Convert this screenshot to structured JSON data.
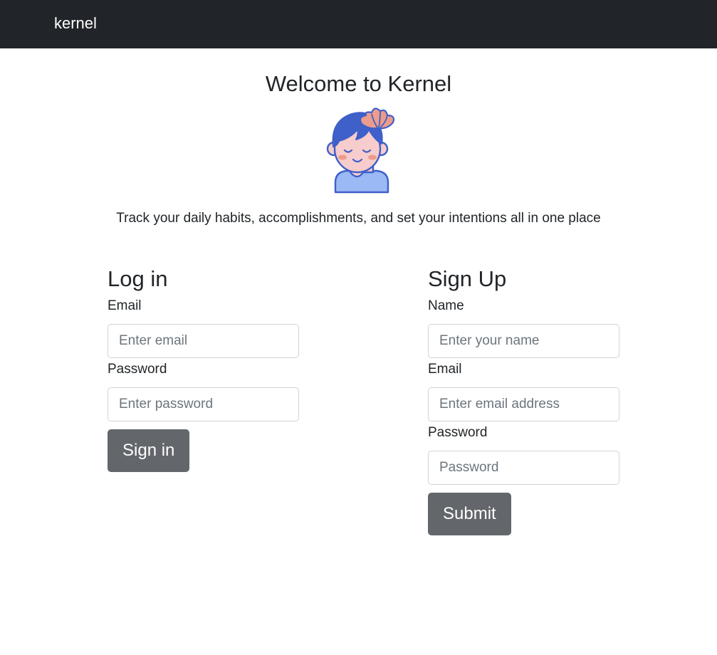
{
  "navbar": {
    "brand": "kernel"
  },
  "hero": {
    "title": "Welcome to Kernel",
    "mascot_icon": "meditating-person-icon",
    "tagline": "Track your daily habits, accomplishments, and set your intentions all in one place"
  },
  "login": {
    "heading": "Log in",
    "email_label": "Email",
    "email_placeholder": "Enter email",
    "email_value": "",
    "password_label": "Password",
    "password_placeholder": "Enter password",
    "password_value": "",
    "submit_label": "Sign in"
  },
  "signup": {
    "heading": "Sign Up",
    "name_label": "Name",
    "name_placeholder": "Enter your name",
    "name_value": "",
    "email_label": "Email",
    "email_placeholder": "Enter email address",
    "email_value": "",
    "password_label": "Password",
    "password_placeholder": "Password",
    "password_value": "",
    "submit_label": "Submit"
  },
  "colors": {
    "navbar_bg": "#212529",
    "button_bg": "#63666b",
    "mascot_hair": "#3f5fc9",
    "mascot_skin": "#f6cccc",
    "mascot_shirt": "#9bb9f5",
    "mascot_flower": "#ec9c8c"
  }
}
